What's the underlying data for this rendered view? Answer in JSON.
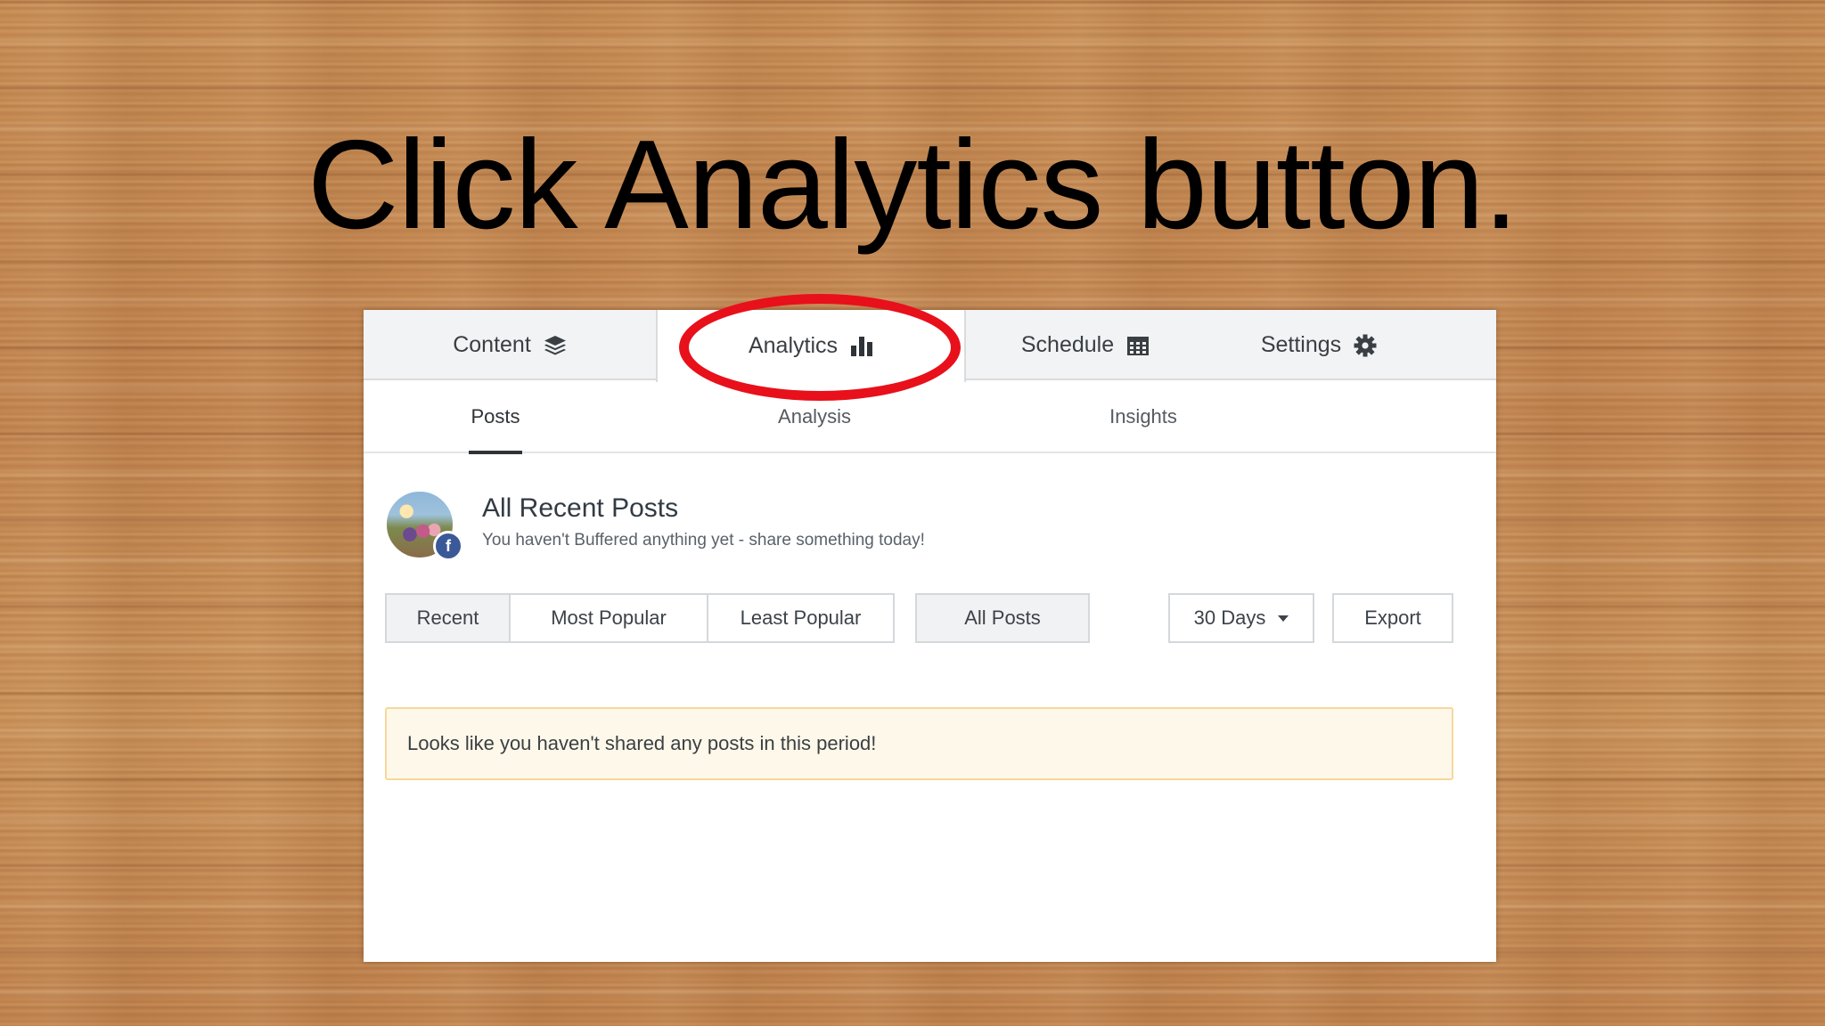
{
  "slide": {
    "instruction": "Click Analytics button."
  },
  "topnav": {
    "tabs": [
      {
        "label": "Content",
        "icon": "layers-icon"
      },
      {
        "label": "Analytics",
        "icon": "bar-chart-icon"
      },
      {
        "label": "Schedule",
        "icon": "calendar-icon"
      },
      {
        "label": "Settings",
        "icon": "gear-icon"
      }
    ],
    "active_tab": "Analytics"
  },
  "subnav": {
    "tabs": [
      {
        "label": "Posts"
      },
      {
        "label": "Analysis"
      },
      {
        "label": "Insights"
      }
    ],
    "active_tab": "Posts"
  },
  "profile": {
    "title": "All Recent Posts",
    "subtitle": "You haven't Buffered anything yet - share something today!",
    "network_badge": "f"
  },
  "filters": {
    "recent": "Recent",
    "most_popular": "Most Popular",
    "least_popular": "Least Popular",
    "all_posts": "All Posts",
    "range": "30 Days",
    "export": "Export"
  },
  "notice": {
    "text": "Looks like you haven't shared any posts in this period!"
  },
  "colors": {
    "highlight_ring": "#e8101a",
    "facebook": "#3b5998",
    "notice_bg": "#fdf8e9",
    "notice_border": "#f6d89a"
  }
}
